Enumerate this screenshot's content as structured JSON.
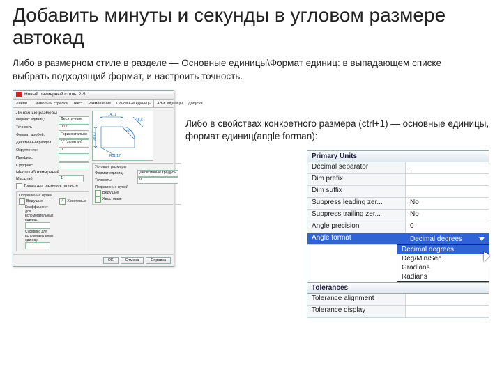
{
  "heading": "Добавить минуты и секунды в угловом размере автокад",
  "para1": "Либо в размерном стиле в разделе — Основные единицы\\Формат единиц: в выпадающем списке выбрать подходящий формат, и настроить точность.",
  "para2": "Либо в свойствах конкретного размера (ctrl+1) — основные единицы, формат единиц(angle forman):",
  "dialog": {
    "title": "Новый размерный стиль: 2-5",
    "tabs": [
      "Линии",
      "Символы и стрелки",
      "Текст",
      "Размещение",
      "Основные единицы",
      "Альт. единицы",
      "Допуски"
    ],
    "active_tab": "Основные единицы",
    "linear_group": "Линейные размеры",
    "rows": {
      "format_label": "Формат единиц:",
      "format_value": "Десятичные",
      "precision_label": "Точность",
      "precision_value": "0.00",
      "fraction_label": "Формат дробей:",
      "fraction_value": "Горизонтально",
      "decsep_label": "Десятичный разделитель:",
      "decsep_value": "\",\" (запятая)",
      "round_label": "Округление:",
      "round_value": "0",
      "prefix_label": "Префикс:",
      "prefix_value": "",
      "suffix_label": "Суффикс:",
      "suffix_value": "",
      "scale_label": "Масштаб измерений",
      "scale2_label": "Масштаб:",
      "scale2_value": "1",
      "only_layout": "Только для размеров на листе",
      "zeros_group": "Подавление нулей",
      "leading": "Ведущие",
      "trailing": "Хвостовые",
      "subunit_label": "Коэффициент для вспомогательных единиц:",
      "subunit_suffix": "Суффикс для вспомогательных единиц:"
    },
    "angular": {
      "group": "Угловые размеры",
      "format_label": "Формат единиц:",
      "format_value": "Десятичные градусы",
      "precision_label": "Точность:",
      "precision_value": "0",
      "zeros": "Подавление нулей",
      "leading": "Ведущие",
      "trailing": "Хвостовые"
    },
    "preview_vals": {
      "a": "14,11",
      "b": "16,6",
      "c": "28,07",
      "d": "60°",
      "r": "R11,17"
    },
    "buttons": {
      "ok": "OK",
      "cancel": "Отмена",
      "help": "Справка"
    }
  },
  "props": {
    "section1": "Primary Units",
    "rows": [
      {
        "name": "Decimal separator",
        "value": "."
      },
      {
        "name": "Dim prefix",
        "value": ""
      },
      {
        "name": "Dim suffix",
        "value": ""
      },
      {
        "name": "Suppress leading zer...",
        "value": "No"
      },
      {
        "name": "Suppress trailing zer...",
        "value": "No"
      },
      {
        "name": "Angle precision",
        "value": "0"
      }
    ],
    "selected": {
      "name": "Angle format",
      "value": "Decimal degrees"
    },
    "dropdown": [
      "Decimal degrees",
      "Deg/Min/Sec",
      "Gradians",
      "Radians"
    ],
    "dropdown_selected": "Decimal degrees",
    "section2": "Tolerances",
    "rows2": [
      {
        "name": "Tolerance alignment",
        "value": ""
      },
      {
        "name": "Tolerance display",
        "value": ""
      }
    ]
  }
}
